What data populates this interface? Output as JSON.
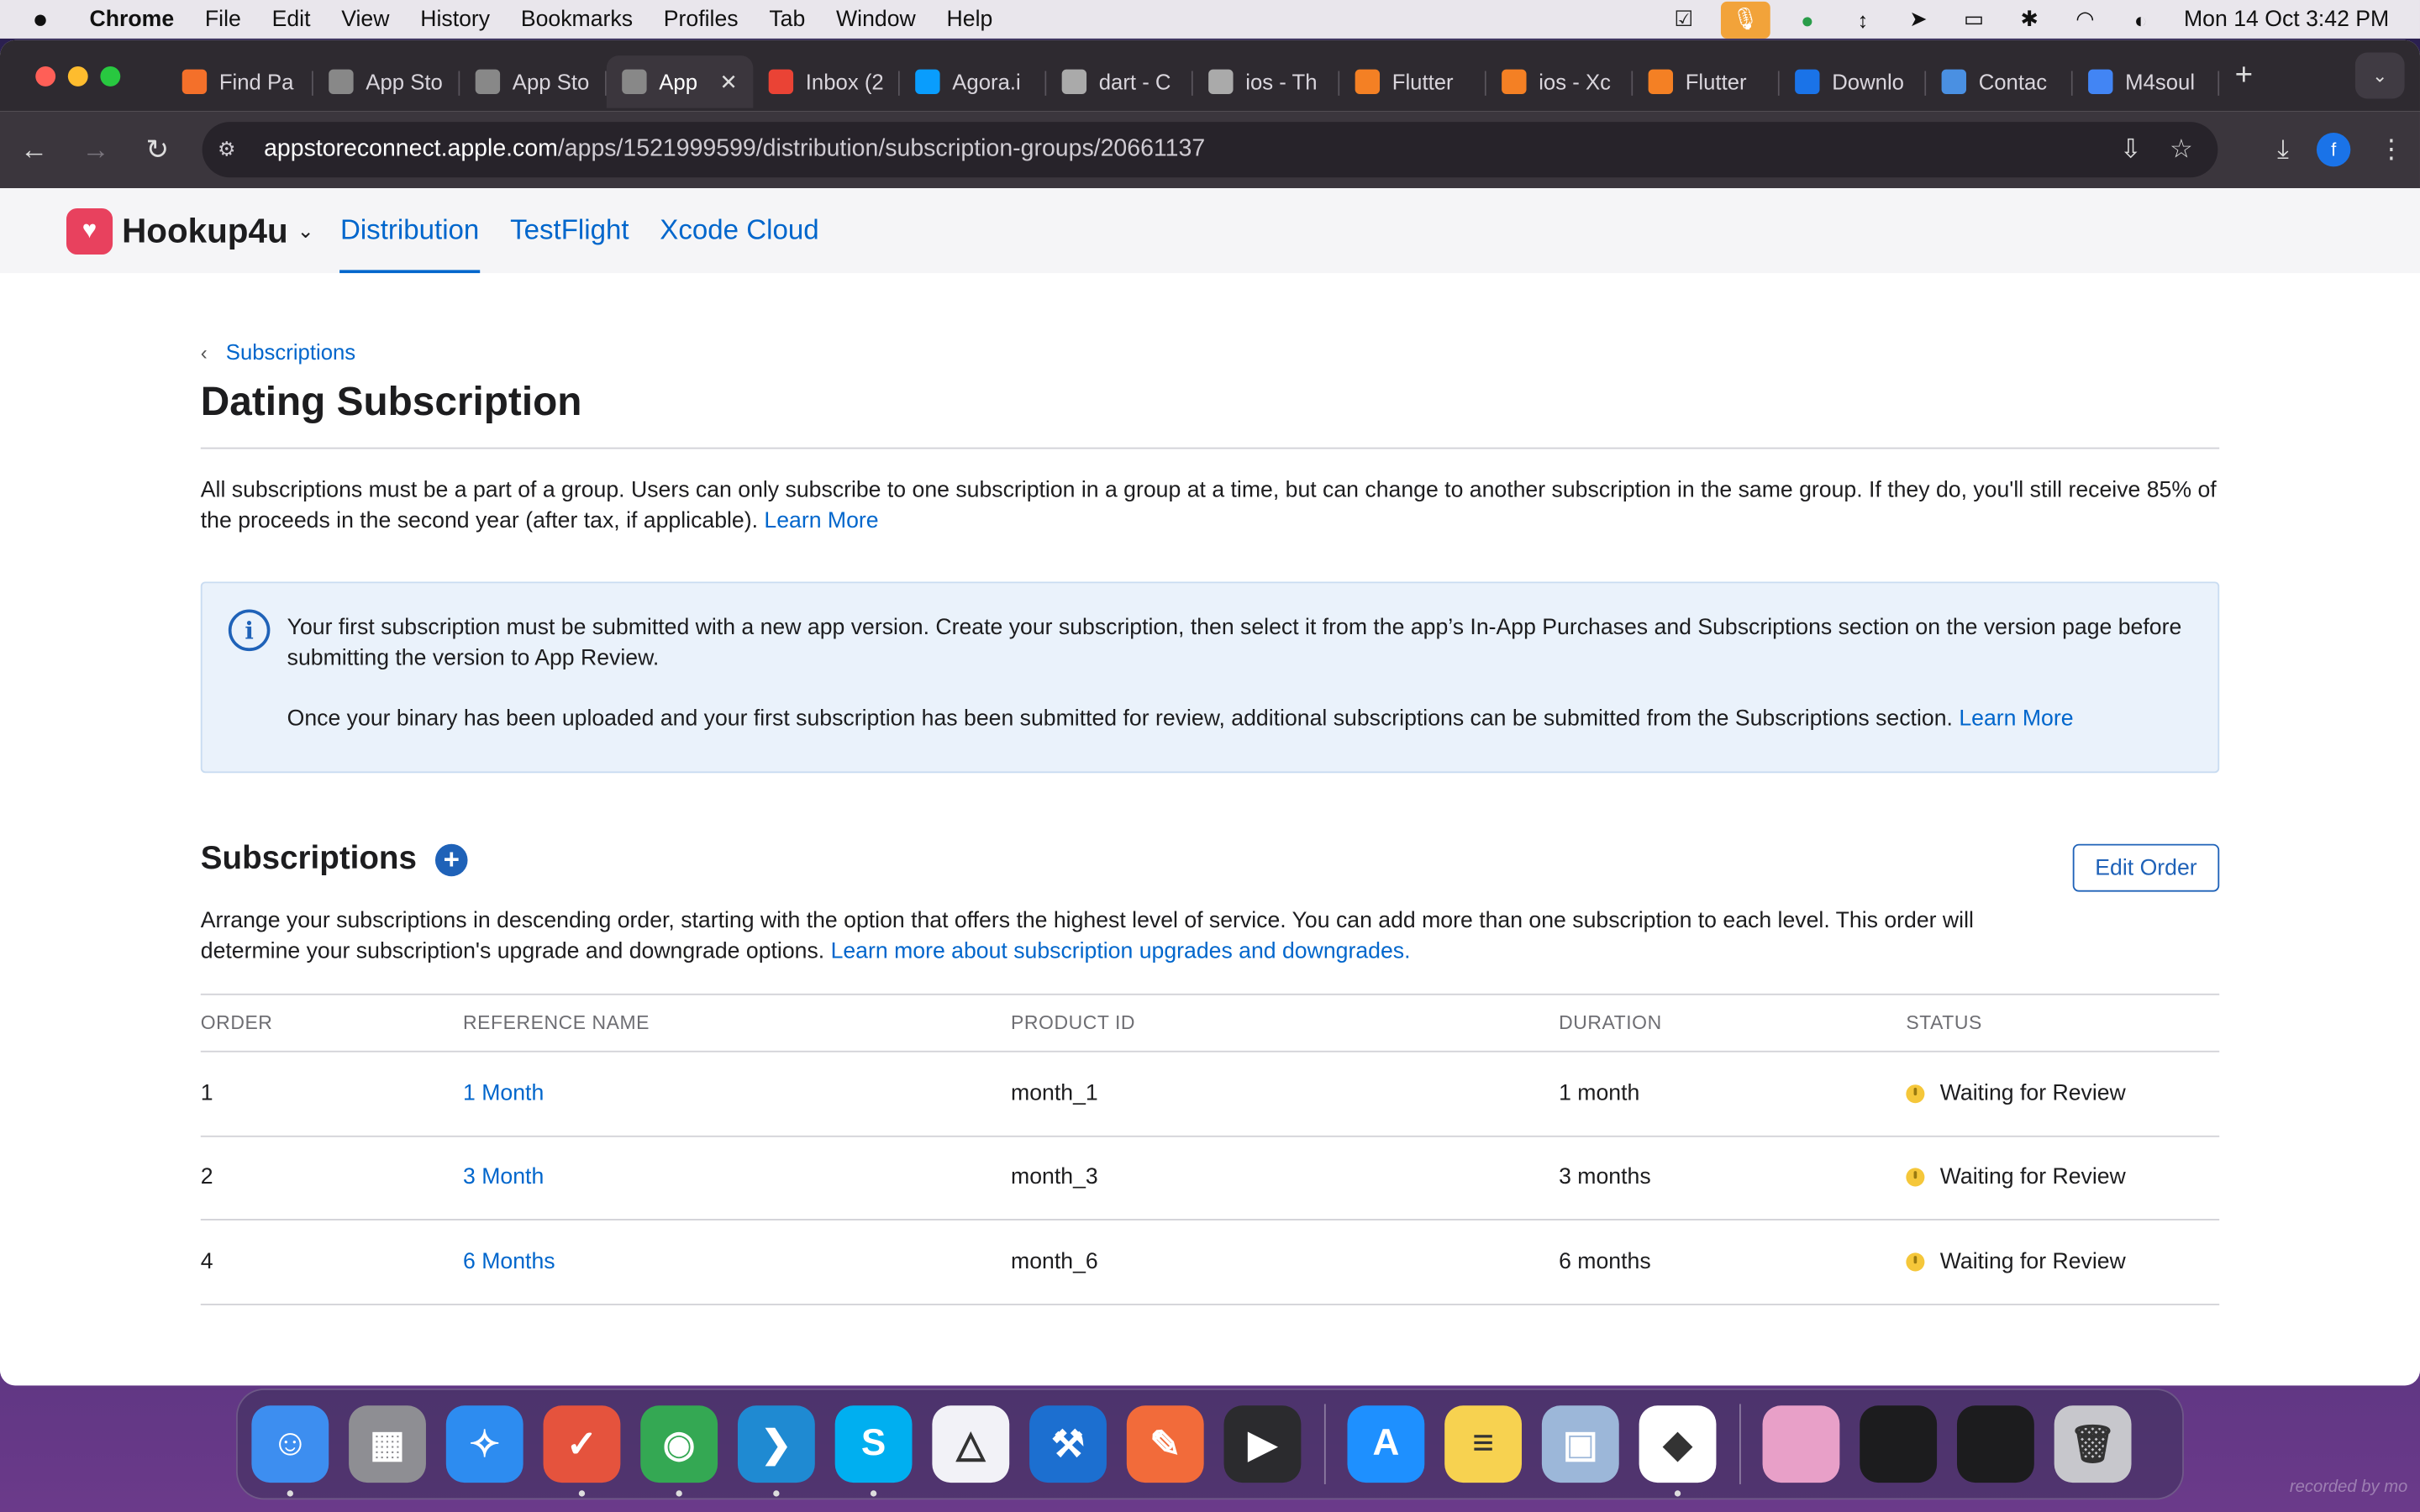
{
  "menubar": {
    "app": "Chrome",
    "items": [
      "File",
      "Edit",
      "View",
      "History",
      "Bookmarks",
      "Profiles",
      "Tab",
      "Window",
      "Help"
    ],
    "clock": "Mon 14 Oct  3:42 PM"
  },
  "tabs": [
    {
      "label": "Find Pa",
      "icon": "fire-icon",
      "color": "#f4702a"
    },
    {
      "label": "App Sto",
      "icon": "apple-icon",
      "color": "#888"
    },
    {
      "label": "App Sto",
      "icon": "apple-icon",
      "color": "#888"
    },
    {
      "label": "App",
      "icon": "apple-icon",
      "color": "#888",
      "active": true
    },
    {
      "label": "Inbox (2",
      "icon": "gmail-icon",
      "color": "#ea4335"
    },
    {
      "label": "Agora.i",
      "icon": "agora-icon",
      "color": "#099dfd"
    },
    {
      "label": "dart - C",
      "icon": "globe-icon",
      "color": "#aaa"
    },
    {
      "label": "ios - Th",
      "icon": "globe-icon",
      "color": "#aaa"
    },
    {
      "label": "Flutter",
      "icon": "stackoverflow-icon",
      "color": "#f48024"
    },
    {
      "label": "ios - Xc",
      "icon": "stackoverflow-icon",
      "color": "#f48024"
    },
    {
      "label": "Flutter",
      "icon": "stackoverflow-icon",
      "color": "#f48024"
    },
    {
      "label": "Downlo",
      "icon": "download-2-icon",
      "color": "#1a73e8"
    },
    {
      "label": "Contac",
      "icon": "contact-icon",
      "color": "#4a90e2"
    },
    {
      "label": "M4soul",
      "icon": "docs-icon",
      "color": "#4285f4"
    }
  ],
  "address": {
    "host": "appstoreconnect.apple.com",
    "path": "/apps/1521999599/distribution/subscription-groups/20661137"
  },
  "app": {
    "name": "Hookup4u",
    "nav": [
      "Distribution",
      "TestFlight",
      "Xcode Cloud"
    ]
  },
  "breadcrumb": "Subscriptions",
  "title": "Dating Subscription",
  "intro": "All subscriptions must be a part of a group. Users can only subscribe to one subscription in a group at a time, but can change to another subscription in the same group. If they do, you'll still receive 85% of the proceeds in the second year (after tax, if applicable).",
  "learn_more": "Learn More",
  "info": {
    "p1": "Your first subscription must be submitted with a new app version. Create your subscription, then select it from the app’s In-App Purchases and Subscriptions section on the version page before submitting the version to App Review.",
    "p2": "Once your binary has been uploaded and your first subscription has been submitted for review, additional subscriptions can be submitted from the Subscriptions section.",
    "link": "Learn More"
  },
  "subscriptions": {
    "heading": "Subscriptions",
    "edit_order": "Edit Order",
    "desc": "Arrange your subscriptions in descending order, starting with the option that offers the highest level of service. You can add more than one subscription to each level. This order will determine your subscription's upgrade and downgrade options.",
    "desc_link": "Learn more about subscription upgrades and downgrades.",
    "columns": [
      "ORDER",
      "REFERENCE NAME",
      "PRODUCT ID",
      "DURATION",
      "STATUS"
    ],
    "rows": [
      {
        "order": "1",
        "name": "1 Month",
        "product_id": "month_1",
        "duration": "1 month",
        "status": "Waiting for Review"
      },
      {
        "order": "2",
        "name": "3 Month",
        "product_id": "month_3",
        "duration": "3 months",
        "status": "Waiting for Review"
      },
      {
        "order": "4",
        "name": "6 Months",
        "product_id": "month_6",
        "duration": "6 months",
        "status": "Waiting for Review"
      }
    ]
  },
  "dock": [
    {
      "name": "finder-icon",
      "color": "#3d8ef0",
      "glyph": "☺"
    },
    {
      "name": "launchpad-icon",
      "color": "#8e8e93",
      "glyph": "▦"
    },
    {
      "name": "safari-icon",
      "color": "#2d8cf0",
      "glyph": "✧"
    },
    {
      "name": "ticktick-icon",
      "color": "#e5533d",
      "glyph": "✓"
    },
    {
      "name": "chrome-icon",
      "color": "#34a853",
      "glyph": "◉"
    },
    {
      "name": "vscode-icon",
      "color": "#1f8ad2",
      "glyph": "❯"
    },
    {
      "name": "skype-icon",
      "color": "#00aff0",
      "glyph": "S"
    },
    {
      "name": "instruments-icon",
      "color": "#f2f2f7",
      "glyph": "△"
    },
    {
      "name": "xcode-icon",
      "color": "#1c6fd0",
      "glyph": "⚒"
    },
    {
      "name": "postman-icon",
      "color": "#f26b3a",
      "glyph": "✎"
    },
    {
      "name": "terminal-icon",
      "color": "#2b2b2e",
      "glyph": "▶"
    },
    {
      "name": "appstore-icon",
      "color": "#1e90ff",
      "glyph": "A"
    },
    {
      "name": "notes-icon",
      "color": "#f7d250",
      "glyph": "≡"
    },
    {
      "name": "preview-icon",
      "color": "#9cb7d9",
      "glyph": "▣"
    },
    {
      "name": "android-studio-icon",
      "color": "#ffffff",
      "glyph": "◆"
    },
    {
      "name": "minimized-window-1-icon",
      "color": "#e8a0c8",
      "glyph": ""
    },
    {
      "name": "minimized-window-2-icon",
      "color": "#1c1c1e",
      "glyph": ""
    },
    {
      "name": "minimized-window-3-icon",
      "color": "#1c1c1e",
      "glyph": ""
    },
    {
      "name": "trash-icon",
      "color": "#c7c7cc",
      "glyph": "🗑"
    }
  ],
  "watermark": "recorded by mo",
  "colors": {
    "accent": "#0066cc",
    "status_pending": "#f5c73a",
    "info_bg": "#eaf2fb"
  }
}
